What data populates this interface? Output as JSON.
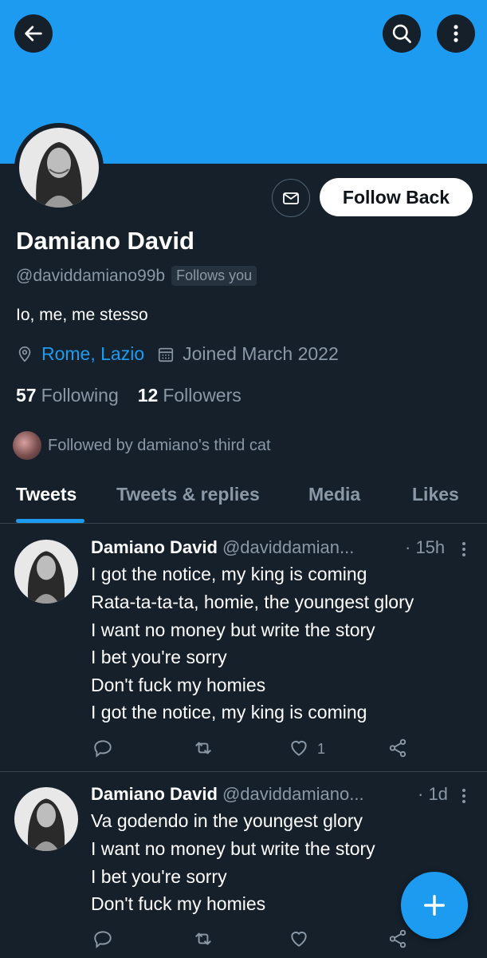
{
  "header": {
    "back_icon": "arrow-left-icon",
    "search_icon": "search-icon",
    "more_icon": "more-vertical-icon",
    "banner_color": "#1d9bf0"
  },
  "profile": {
    "name": "Damiano David",
    "handle": "@daviddamiano99b",
    "follows_you": "Follows you",
    "bio": "Io, me, me stesso",
    "location": "Rome, Lazio",
    "joined": "Joined March 2022",
    "following_count": "57",
    "following_label": "Following",
    "followers_count": "12",
    "followers_label": "Followers",
    "followed_by": "Followed by damiano's third cat",
    "follow_button": "Follow Back",
    "message_icon": "mail-icon"
  },
  "tabs": [
    {
      "label": "Tweets",
      "active": true
    },
    {
      "label": "Tweets & replies",
      "active": false
    },
    {
      "label": "Media",
      "active": false
    },
    {
      "label": "Likes",
      "active": false
    }
  ],
  "tweets": [
    {
      "name": "Damiano David",
      "handle": "@daviddamian...",
      "time": "· 15h",
      "lines": [
        "I got the notice, my king is coming",
        "Rata-ta-ta-ta, homie, the youngest glory",
        "I want no money but write the story",
        "I bet you're sorry",
        "Don't fuck my homies",
        "I got the notice, my king is coming"
      ],
      "likes": "1"
    },
    {
      "name": "Damiano David",
      "handle": "@daviddamiano...",
      "time": "· 1d",
      "lines": [
        "Va godendo in the youngest glory",
        "I want no money but write the story",
        "I bet you're sorry",
        "Don't fuck my homies"
      ],
      "likes": ""
    }
  ],
  "fab": {
    "icon": "plus-icon"
  },
  "colors": {
    "accent": "#1d9bf0",
    "background": "#15202b",
    "muted": "#8b98a5"
  }
}
